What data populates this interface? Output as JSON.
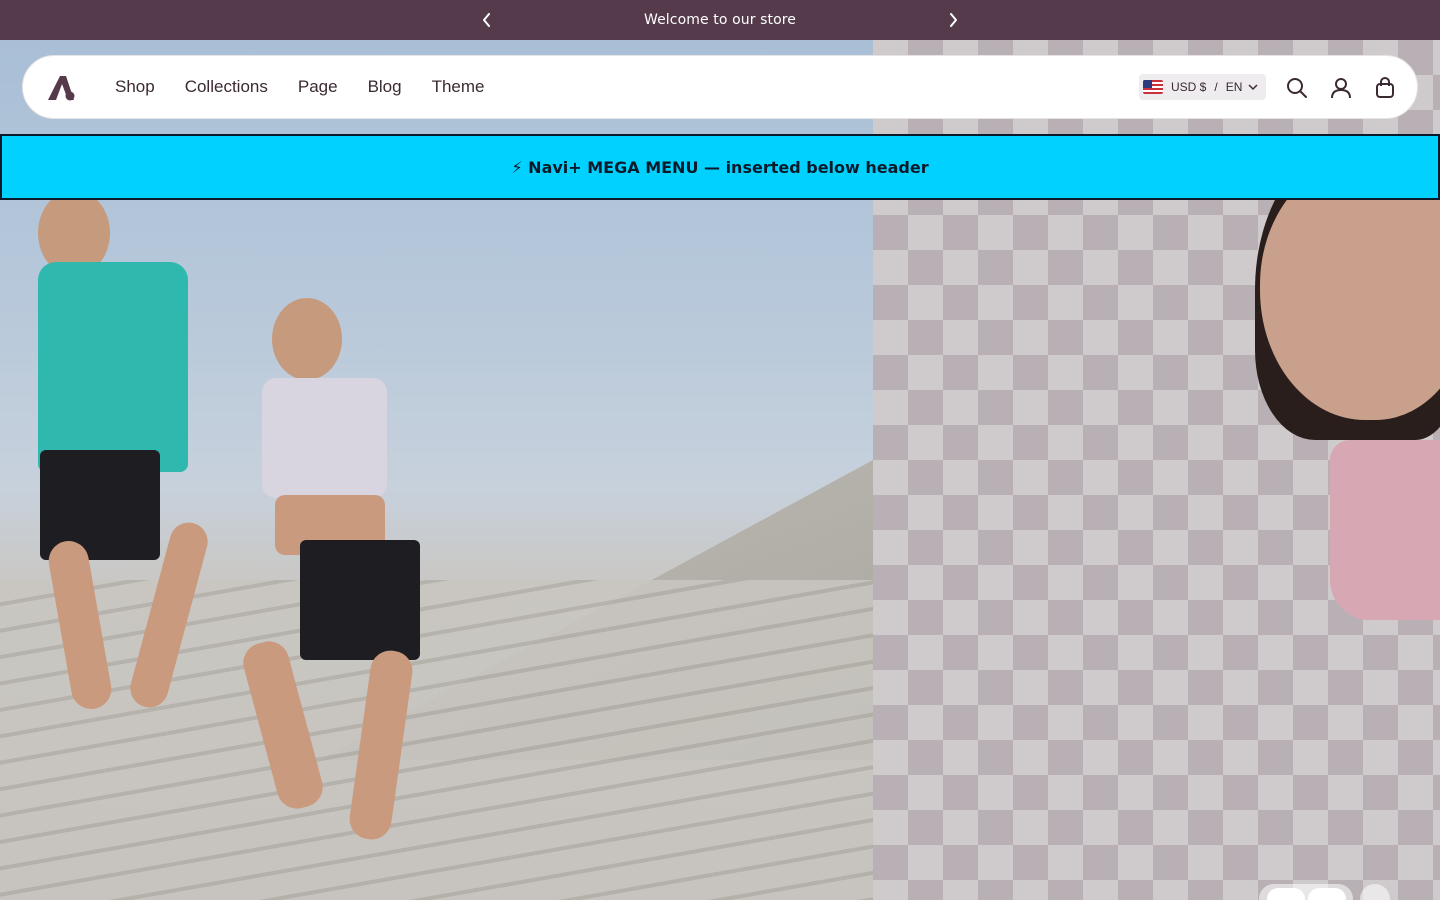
{
  "announcement": {
    "text": "Welcome to our store",
    "prev_icon": "chevron-left-icon",
    "next_icon": "chevron-right-icon",
    "background": "#553a4c"
  },
  "header": {
    "logo_icon": "brand-logo-icon",
    "nav": [
      "Shop",
      "Collections",
      "Page",
      "Blog",
      "Theme"
    ],
    "locale": {
      "currency": "USD $",
      "separator": "/",
      "language": "EN",
      "flag_icon": "us-flag-icon"
    },
    "icons": [
      "search-icon",
      "account-icon",
      "cart-icon"
    ]
  },
  "mega_menu": {
    "text": "⚡ Navi+ MEGA MENU — inserted below header",
    "background": "#00d1ff"
  },
  "slider": {
    "controls": [
      "prev-slide",
      "next-slide",
      "pause"
    ]
  }
}
